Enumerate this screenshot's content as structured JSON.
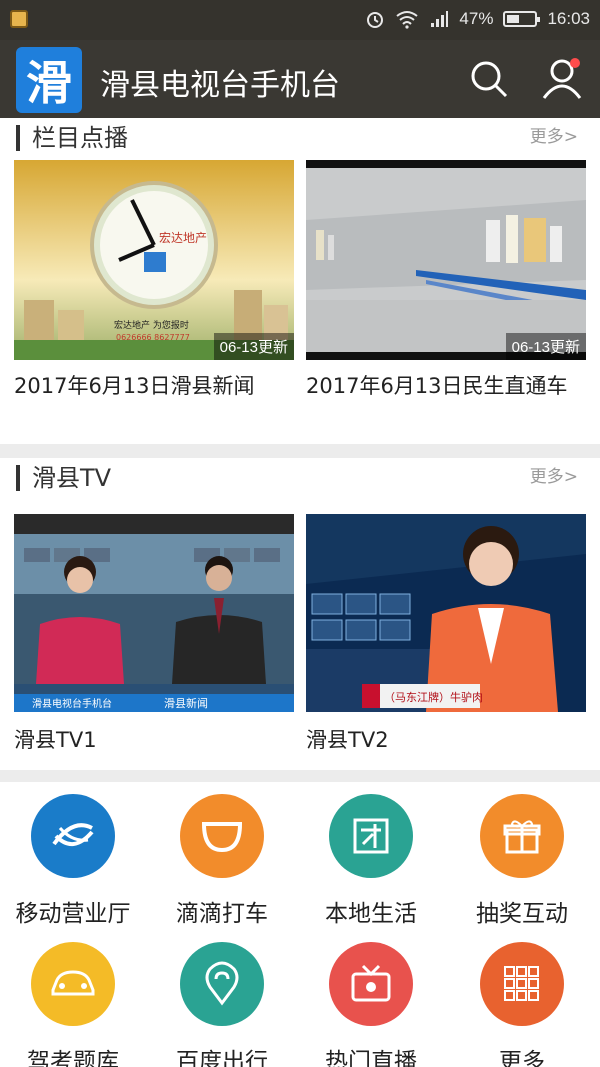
{
  "status": {
    "battery_percent": "47%",
    "time": "16:03",
    "battery_level": 0.47,
    "left_icon": "notification-app-icon"
  },
  "appbar": {
    "logo_text": "滑",
    "title": "滑县电视台手机台",
    "search_icon": "search-icon",
    "user_icon": "user-icon"
  },
  "section_programs": {
    "title": "栏目点播",
    "more": "更多>",
    "items": [
      {
        "caption": "2017年6月13日滑县新闻",
        "badge": "06-13更新"
      },
      {
        "caption": "2017年6月13日民生直通车",
        "badge": "06-13更新"
      }
    ]
  },
  "section_tv": {
    "title": "滑县TV",
    "more": "更多>",
    "items": [
      {
        "caption": "滑县TV1",
        "overlay_left": "滑县电视台手机台",
        "overlay_right": "滑县新闻"
      },
      {
        "caption": "滑县TV2",
        "overlay_right": "（马东江牌）牛驴肉"
      }
    ]
  },
  "services": [
    {
      "label": "移动营业厅",
      "icon": "china-mobile-icon",
      "color": "#1a7cc9"
    },
    {
      "label": "滴滴打车",
      "icon": "didi-icon",
      "color": "#f28c2b"
    },
    {
      "label": "本地生活",
      "icon": "local-life-icon",
      "color": "#2aa393"
    },
    {
      "label": "抽奖互动",
      "icon": "gift-icon",
      "color": "#f28c2b"
    },
    {
      "label": "驾考题库",
      "icon": "car-icon",
      "color": "#f4bb27"
    },
    {
      "label": "百度出行",
      "icon": "location-icon",
      "color": "#2aa393"
    },
    {
      "label": "热门直播",
      "icon": "live-tv-icon",
      "color": "#e8524d"
    },
    {
      "label": "更多",
      "icon": "grid-icon",
      "color": "#e8622f"
    }
  ]
}
